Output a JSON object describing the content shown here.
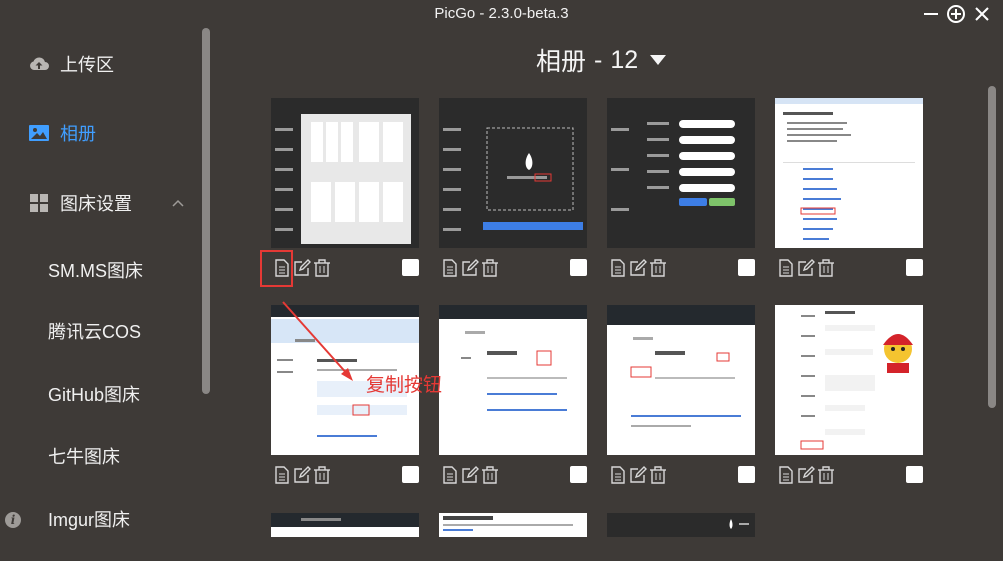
{
  "window": {
    "title": "PicGo - 2.3.0-beta.3",
    "controls": [
      "minimize-icon",
      "maximize-icon",
      "close-icon"
    ]
  },
  "sidebar": {
    "items": [
      {
        "label": "上传区",
        "icon": "cloud-upload-icon",
        "active": false
      },
      {
        "label": "相册",
        "icon": "image-icon",
        "active": true
      },
      {
        "label": "图床设置",
        "icon": "grid-icon",
        "active": false,
        "expanded": true
      }
    ],
    "sub_items": [
      "SM.MS图床",
      "腾讯云COS",
      "GitHub图床",
      "七牛图床",
      "Imgur图床"
    ],
    "info_icon": "i"
  },
  "main": {
    "album_label": "相册",
    "separator": "-",
    "count": "12",
    "card_actions": [
      "copy-icon",
      "edit-icon",
      "delete-icon"
    ],
    "annotation": "复制按钮"
  },
  "colors": {
    "background": "#3e3a37",
    "active": "#409eff",
    "annotation": "#e53935"
  }
}
